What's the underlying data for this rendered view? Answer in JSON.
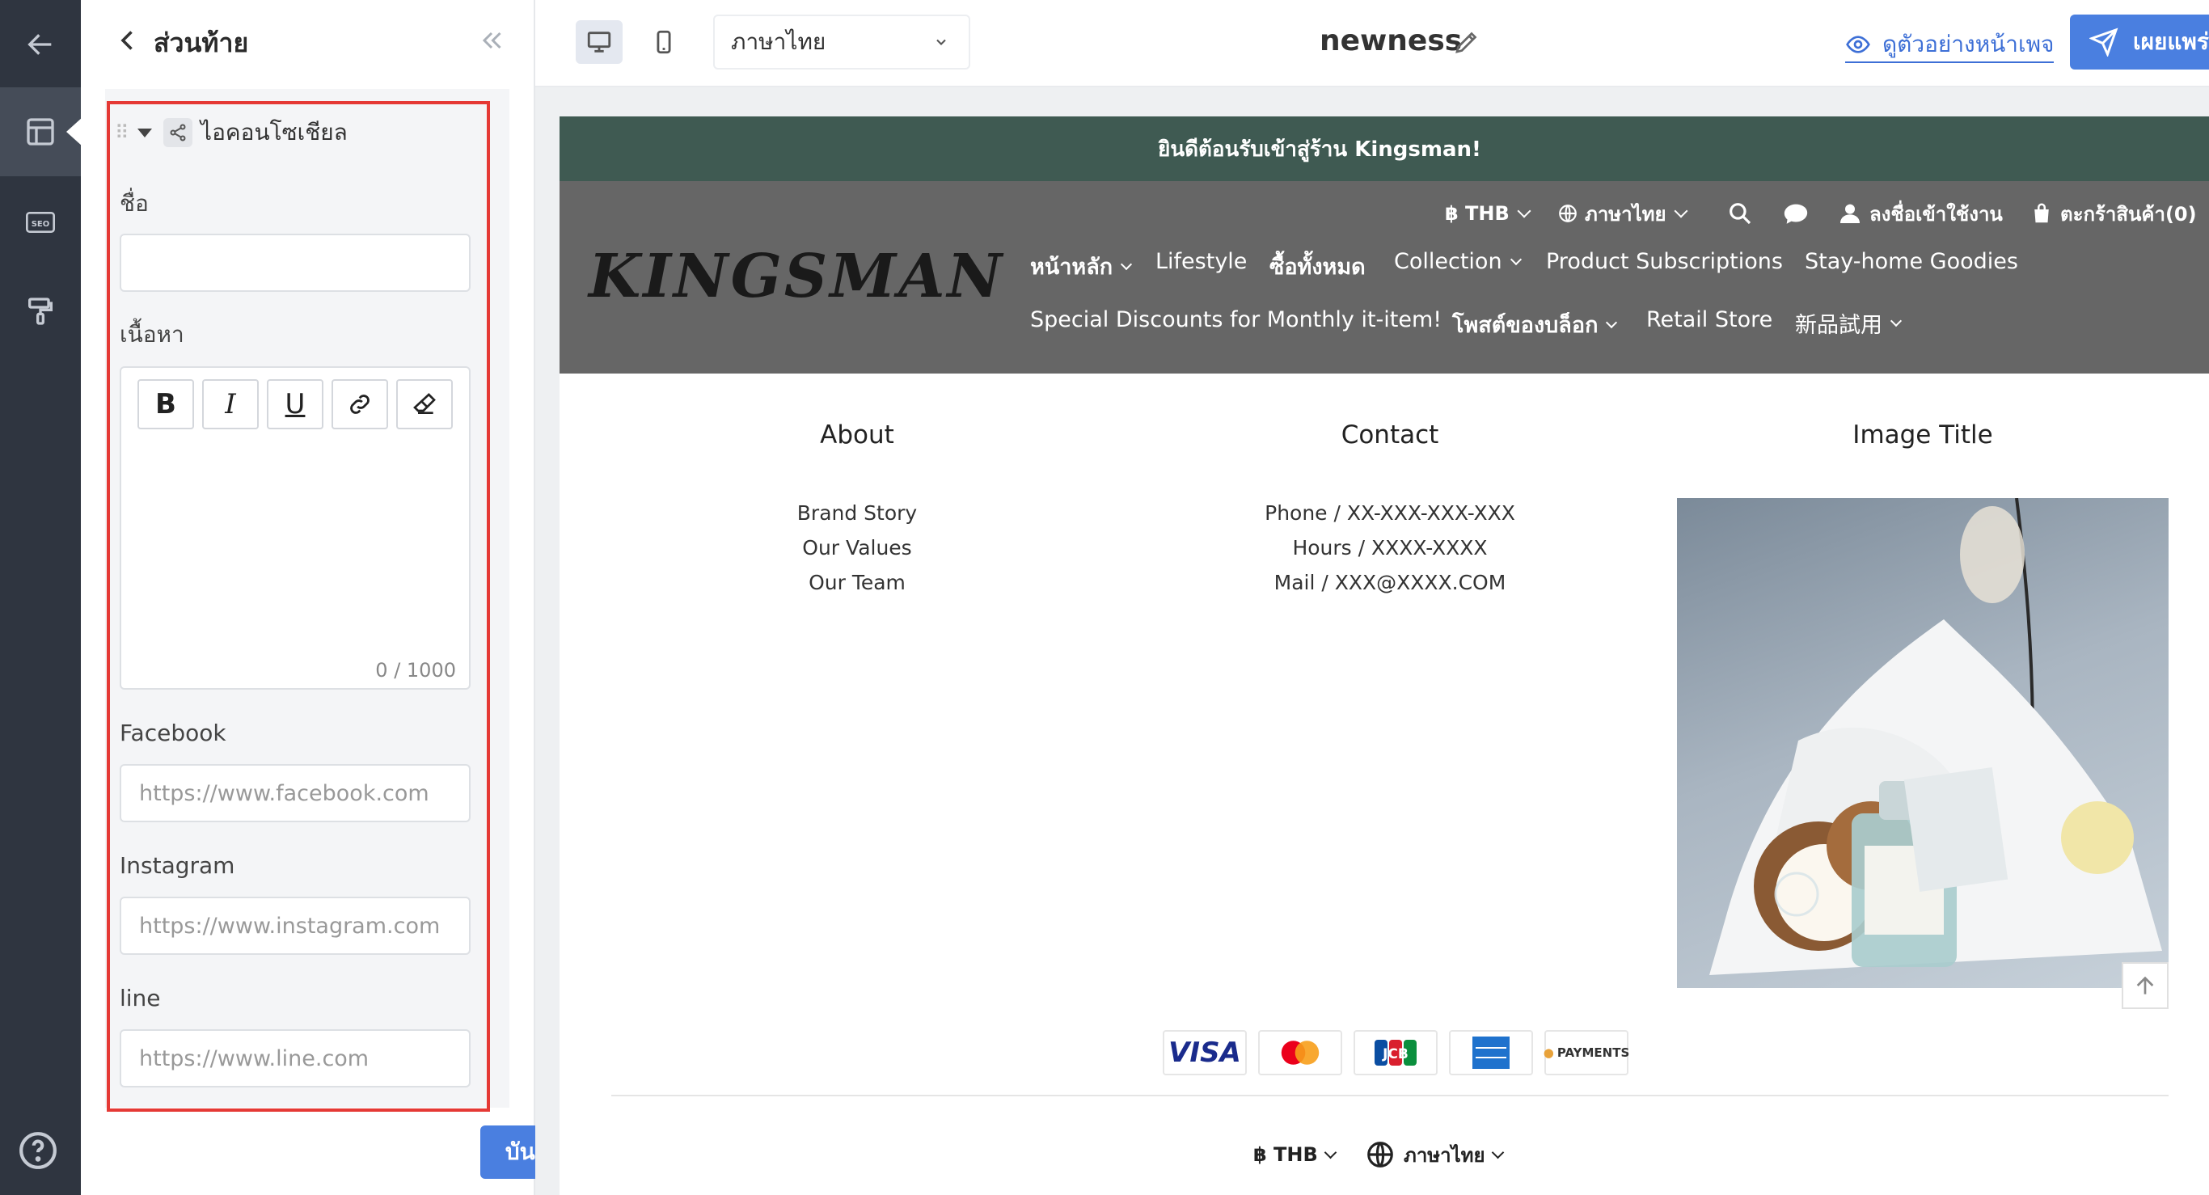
{
  "panel": {
    "title": "ส่วนท้าย",
    "section_title": "ไอคอนโซเชียล",
    "name_label": "ชื่อ",
    "name_value": "",
    "content_label": "เนื้อหา",
    "toolbar": {
      "bold": "B",
      "italic": "I",
      "underline": "U"
    },
    "counter": "0 / 1000",
    "facebook_label": "Facebook",
    "facebook_placeholder": "https://www.facebook.com",
    "instagram_label": "Instagram",
    "instagram_placeholder": "https://www.instagram.com",
    "line_label": "line",
    "line_placeholder": "https://www.line.com",
    "save_label": "บันทึก"
  },
  "topbar": {
    "language": "ภาษาไทย",
    "page_name": "newness",
    "preview_label": "ดูตัวอย่างหน้าเพจ",
    "publish_label": "เผยแพร่"
  },
  "site": {
    "announcement": "ยินดีต้อนรับเข้าสู่ร้าน Kingsman!",
    "logo": "KINGSMAN",
    "utility": {
      "currency": "฿ THB",
      "language": "ภาษาไทย",
      "login": "ลงชื่อเข้าใช้งาน",
      "cart": "ตะกร้าสินค้า(0)"
    },
    "menu": [
      "หน้าหลัก",
      "Lifestyle",
      "ซื้อทั้งหมด",
      "Collection",
      "Product Subscriptions",
      "Stay-home Goodies",
      "Special Discounts for Monthly it-item!",
      "โพสต์ของบล็อก",
      "Retail Store",
      "新品試用"
    ],
    "footer": {
      "about_title": "About",
      "about_links": [
        "Brand Story",
        "Our Values",
        "Our Team"
      ],
      "contact_title": "Contact",
      "contact_lines": [
        "Phone / XX-XXX-XXX-XXX",
        "Hours / XXXX-XXXX",
        "Mail / XXX@XXXX.COM"
      ],
      "image_title": "Image Title",
      "payments": [
        "VISA",
        "JCB",
        "PAYMENTS"
      ],
      "currency": "฿ THB",
      "language": "ภาษาไทย"
    }
  },
  "colors": {
    "rail": "#2f3540",
    "accent": "#4a7fe0",
    "highlight": "#e53935",
    "announcement_bg": "#3f5a52",
    "nav_bg": "#666666"
  }
}
